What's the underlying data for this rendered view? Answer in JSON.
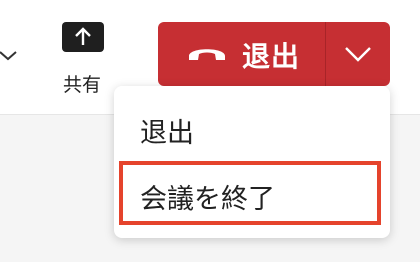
{
  "toolbar": {
    "share_label": "共有",
    "share_icon": "share-upload-icon",
    "left_chevron_icon": "chevron-down-icon"
  },
  "leave": {
    "button_label": "退出",
    "icon": "hang-up-phone-icon",
    "dropdown_icon": "chevron-down-icon",
    "color": "#c62f33"
  },
  "menu": {
    "items": [
      {
        "label": "退出"
      },
      {
        "label": "会議を終了",
        "highlighted": true
      }
    ],
    "highlight_color": "#e5432c"
  }
}
